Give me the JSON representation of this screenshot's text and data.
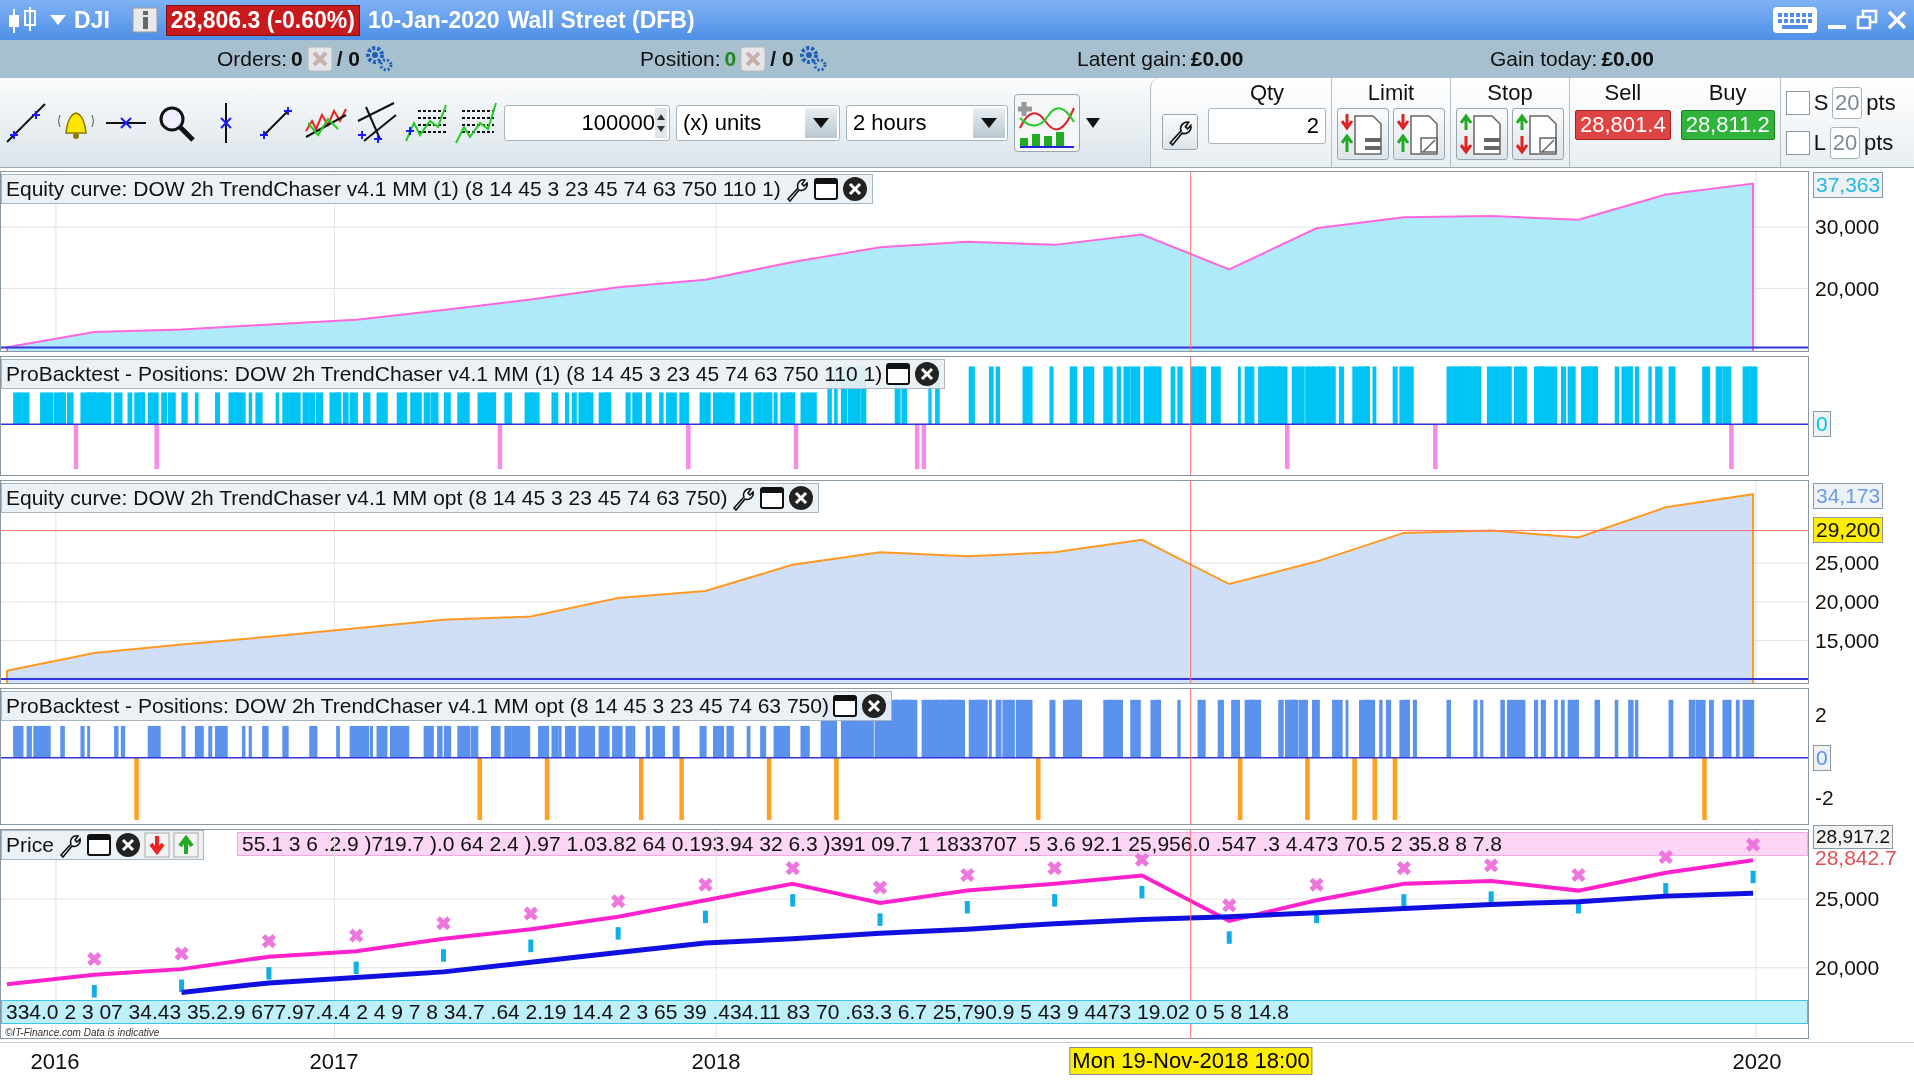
{
  "title_bar": {
    "symbol": "DJI",
    "price_change": "28,806.3 (-0.60%)",
    "date": "10-Jan-2020",
    "instrument": "Wall Street (DFB)"
  },
  "info_bar": {
    "orders_label": "Orders:",
    "orders_count": "0",
    "orders_pending": "/ 0",
    "position_label": "Position:",
    "position_count": "0",
    "position_pending": "/ 0",
    "latent_gain_label": "Latent gain:",
    "latent_gain": "£0.00",
    "gain_today_label": "Gain today:",
    "gain_today": "£0.00"
  },
  "toolbar": {
    "units_value": "100000",
    "units_type": "(x) units",
    "period": "2 hours",
    "qty_label": "Qty",
    "qty": "2",
    "limit_label": "Limit",
    "stop_label": "Stop",
    "sell_label": "Sell",
    "sell_price": "28,801.4",
    "buy_label": "Buy",
    "buy_price": "28,811.2",
    "options": [
      {
        "label": "S",
        "value": "20",
        "unit": "pts",
        "checked": false
      },
      {
        "label": "L",
        "value": "20",
        "unit": "pts",
        "checked": false
      }
    ]
  },
  "panels": [
    {
      "kind": "equity",
      "title": "Equity curve: DOW 2h TrendChaser v4.1 MM (1) (8 14 45 3 23 45 74 63 750 110 1)",
      "last_value": "37,363",
      "chart_data": {
        "type": "area",
        "grid": true,
        "ylim": [
          9800,
          38980
        ],
        "ref_lines": [
          {
            "axis": "y",
            "value": 10380,
            "color": "#3333dd"
          }
        ],
        "yticks": [
          {
            "value": 20000,
            "label": "20,000"
          },
          {
            "value": 30000,
            "label": "30,000"
          }
        ],
        "categories": [
          null,
          null,
          null,
          null,
          null,
          null,
          null,
          null,
          null,
          null,
          null,
          null,
          null,
          null,
          null,
          null,
          null,
          null,
          null,
          null,
          null
        ],
        "series": [
          {
            "color": "#ff66dd",
            "values": [
              10400,
              12900,
              13300,
              14100,
              14900,
              16500,
              18200,
              20200,
              21400,
              24300,
              26700,
              27600,
              27100,
              28800,
              23100,
              29800,
              31600,
              31800,
              31200,
              35300,
              37100
            ]
          }
        ]
      }
    },
    {
      "kind": "positions",
      "title": "ProBacktest - Positions: DOW 2h TrendChaser v4.1 MM (1) (8 14 45 3 23 45 74 63 750 110 1)",
      "zero_label": "0"
    },
    {
      "kind": "equity",
      "title": "Equity curve: DOW 2h TrendChaser v4.1 MM opt (8 14 45 3 23 45 74 63 750)",
      "last_value": "34,173",
      "cursor_value": "29,200",
      "chart_data": {
        "type": "area",
        "grid": true,
        "ylim": [
          9530,
          35600
        ],
        "ref_lines": [
          {
            "axis": "y",
            "value": 10050,
            "color": "#3333dd"
          },
          {
            "axis": "y",
            "value": 29200,
            "color": "#ff7070"
          }
        ],
        "yticks": [
          {
            "value": 15000,
            "label": "15,000"
          },
          {
            "value": 20000,
            "label": "20,000"
          },
          {
            "value": 25000,
            "label": "25,000"
          }
        ],
        "categories": [
          null,
          null,
          null,
          null,
          null,
          null,
          null,
          null,
          null,
          null,
          null,
          null,
          null,
          null,
          null,
          null,
          null,
          null,
          null,
          null,
          null
        ],
        "series": [
          {
            "color": "#ff9922",
            "values": [
              11100,
              13400,
              14500,
              15500,
              16600,
              17700,
              18100,
              20500,
              21400,
              24800,
              26400,
              25900,
              26400,
              28000,
              22300,
              25200,
              28900,
              29200,
              28300,
              32200,
              33900
            ]
          }
        ]
      }
    },
    {
      "kind": "positions",
      "title": "ProBacktest - Positions: DOW 2h TrendChaser v4.1 MM opt (8 14 45 3 23 45 74 63 750)",
      "zero_label": "0",
      "ticks": [
        "2",
        "-2"
      ]
    },
    {
      "kind": "price",
      "title": "Price",
      "top_strip": "55.1 3 6 .2.9 )719.7 ).0 64 2.4 ).97 1.03.82 64 0.193.94 32 6.3 )391 09.7 1 1833707 .5 3.6 92.1 25,956.0 .547 .3 4.473 70.5 2 35.8 8 7.8",
      "bottom_strip": "334.0 2 3 07 34.43 35.2.9 677.97.4.4 2 4 9 7 8 34.7 .64 2.19 14.4 2 3 65 39 .434.11 83 70 .63.3 6.7 25,790.9 5 43 9 4473 19.02 0 5 8 14.8",
      "copyright": "©IT-Finance.com  Data is indicative",
      "high_label": "28,917.2",
      "last_label": "28,842.7",
      "chart_data": {
        "type": "line",
        "grid": true,
        "ylim": [
          14900,
          30000
        ],
        "yticks": [
          {
            "value": 20000,
            "label": "20,000"
          },
          {
            "value": 25000,
            "label": "25,000"
          }
        ],
        "categories": [
          null,
          null,
          null,
          null,
          null,
          null,
          null,
          null,
          null,
          null,
          null,
          null,
          null,
          null,
          null,
          null,
          null,
          null,
          null,
          null,
          null
        ],
        "series": [
          {
            "color": "#ff22cc",
            "values": [
              18800,
              19500,
              19900,
              20800,
              21200,
              22100,
              22800,
              23700,
              24900,
              26100,
              24700,
              25600,
              26100,
              26700,
              23400,
              24900,
              26100,
              26300,
              25600,
              26900,
              27800
            ]
          },
          {
            "color": "#1010e0",
            "values": [
              null,
              null,
              18200,
              18900,
              19300,
              19700,
              20400,
              21100,
              21800,
              22100,
              22500,
              22800,
              23200,
              23500,
              23700,
              24000,
              24300,
              24600,
              24800,
              25200,
              25400
            ]
          }
        ]
      }
    }
  ],
  "time_axis": {
    "labels": [
      "2016",
      "2017",
      "2018",
      "2020"
    ],
    "cursor": "Mon 19-Nov-2018 18:00"
  }
}
